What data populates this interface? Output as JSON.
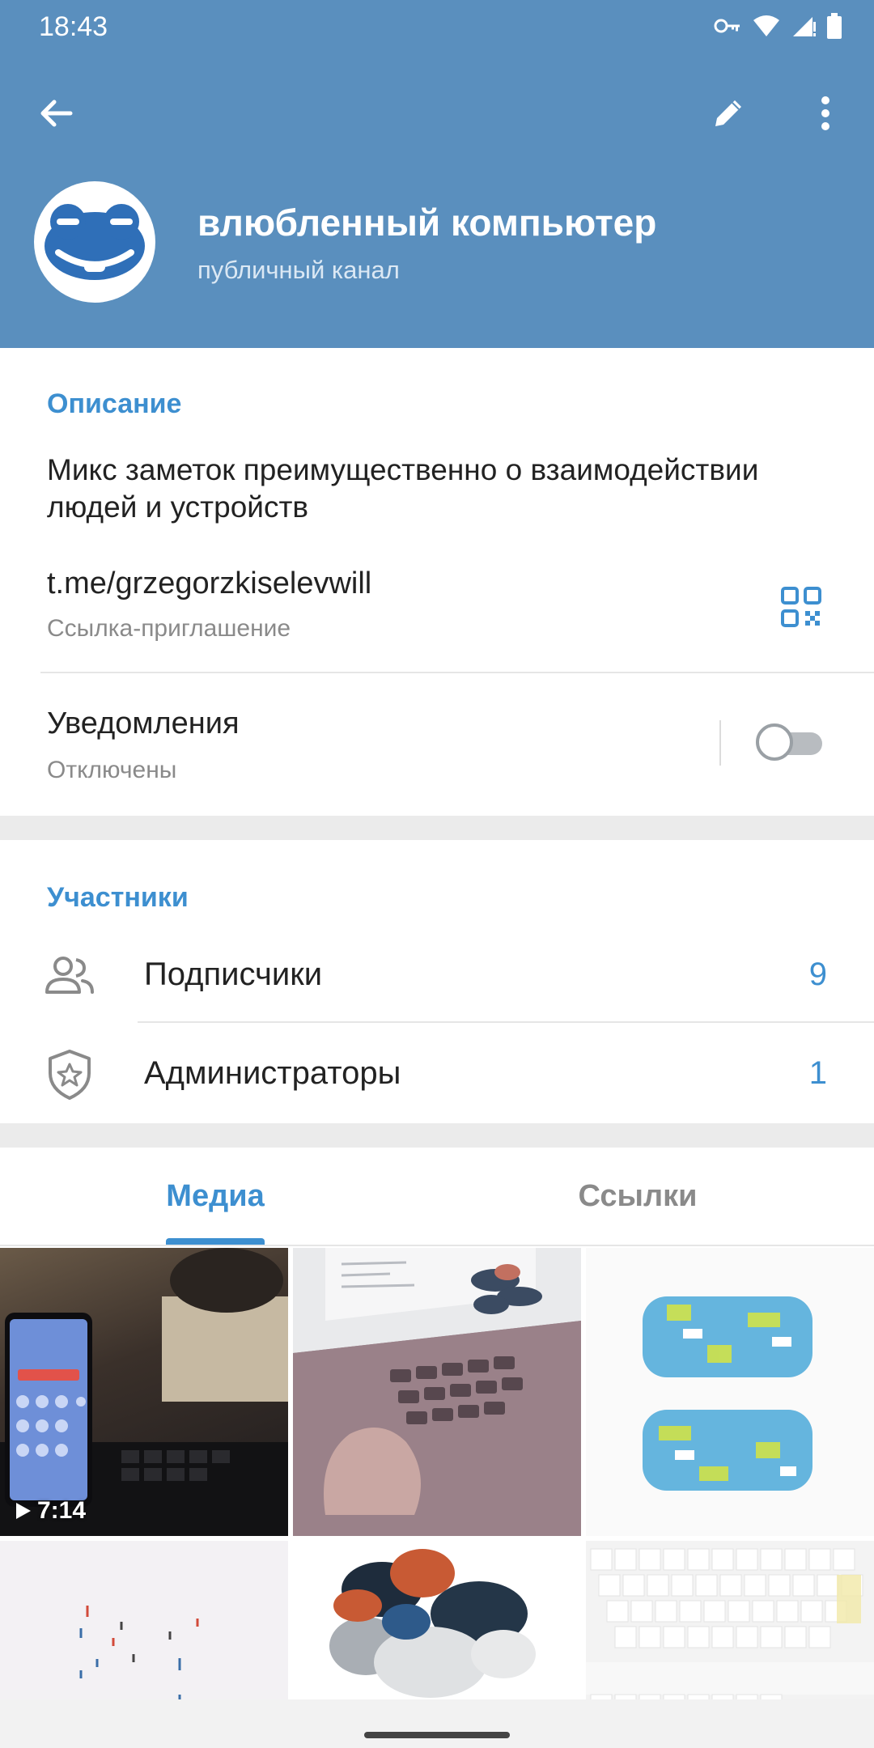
{
  "status_bar": {
    "time": "18:43",
    "icons": [
      "vpn-key-icon",
      "wifi-icon",
      "signal-icon",
      "battery-icon"
    ]
  },
  "toolbar": {
    "back_icon": "arrow-left-icon",
    "edit_icon": "pencil-icon",
    "more_icon": "more-vertical-icon"
  },
  "channel": {
    "title": "влюбленный компьютер",
    "subtitle": "публичный канал",
    "avatar_icon": "frog-face-icon"
  },
  "info": {
    "description_title": "Описание",
    "description_text": "Микс заметок преимущественно о взаимодействии людей и устройств",
    "link": "t.me/grzegorzkiselevwill",
    "link_caption": "Ссылка-приглашение",
    "qr_icon": "qr-code-icon",
    "notifications_title": "Уведомления",
    "notifications_status": "Отключены",
    "notifications_enabled": false
  },
  "members": {
    "title": "Участники",
    "rows": [
      {
        "label": "Подписчики",
        "count": "9",
        "icon": "people-icon"
      },
      {
        "label": "Администраторы",
        "count": "1",
        "icon": "shield-star-icon"
      }
    ]
  },
  "media_tabs": {
    "tabs": [
      "Медиа",
      "Ссылки"
    ],
    "active": "Медиа"
  },
  "media": {
    "items": [
      {
        "kind": "video",
        "duration": "7:14"
      },
      {
        "kind": "photo"
      },
      {
        "kind": "photo"
      },
      {
        "kind": "photo"
      },
      {
        "kind": "photo"
      },
      {
        "kind": "photo"
      }
    ]
  },
  "colors": {
    "header": "#5a8fbe",
    "accent": "#3d8fd0",
    "background": "#ebebeb"
  }
}
